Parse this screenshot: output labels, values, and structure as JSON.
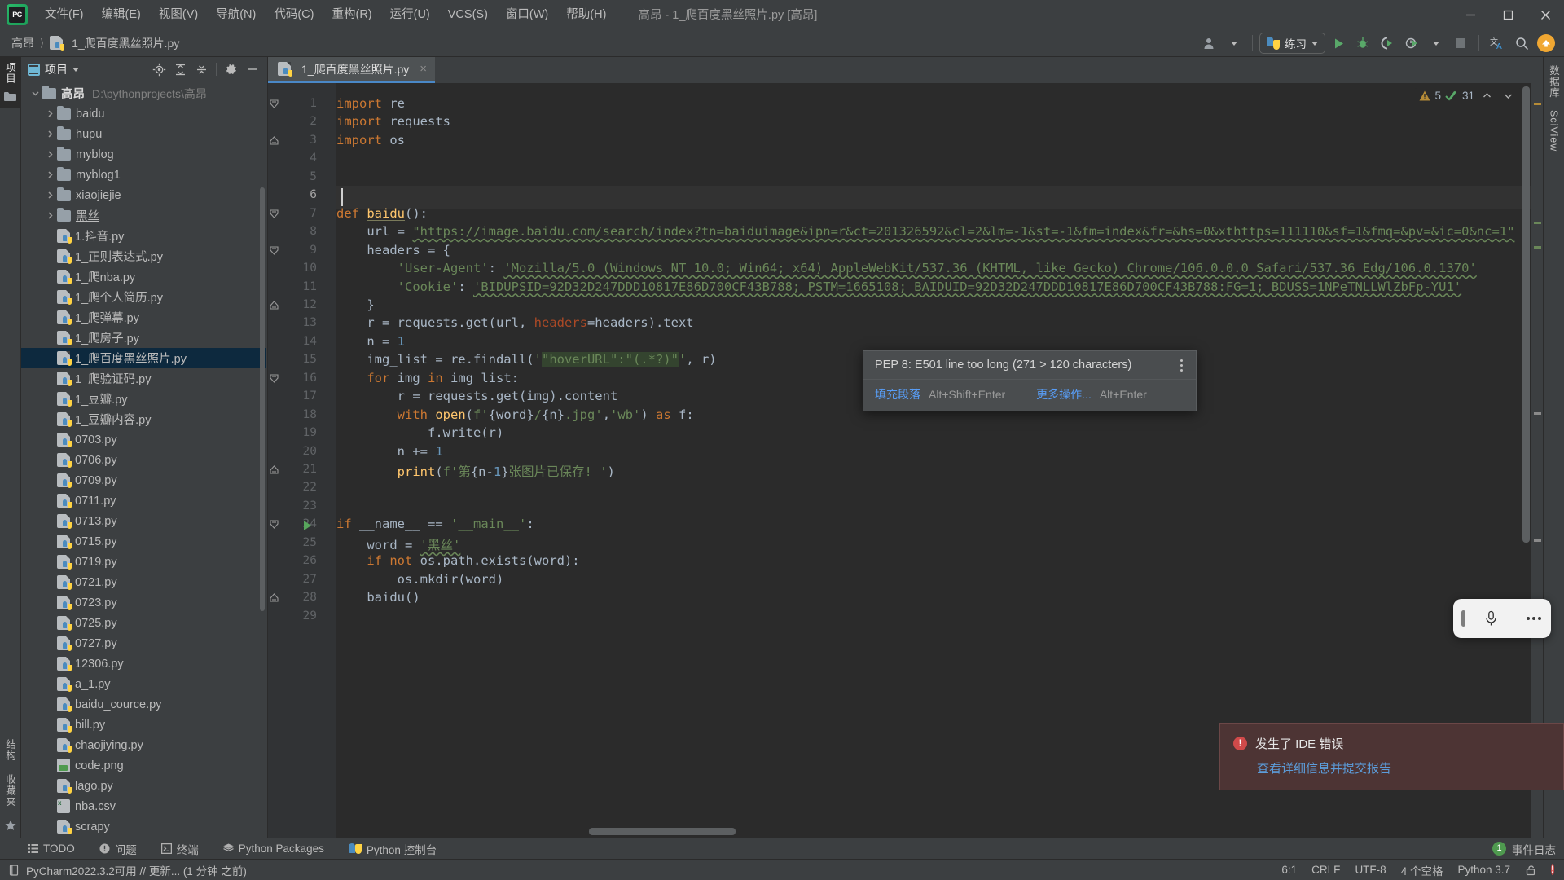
{
  "window": {
    "title": "高昂 - 1_爬百度黑丝照片.py [高昂]",
    "app_icon": "pycharm-logo"
  },
  "menubar": [
    {
      "label": "文件(F)",
      "accel": "F"
    },
    {
      "label": "编辑(E)",
      "accel": "E"
    },
    {
      "label": "视图(V)",
      "accel": "V"
    },
    {
      "label": "导航(N)",
      "accel": "N"
    },
    {
      "label": "代码(C)",
      "accel": "C"
    },
    {
      "label": "重构(R)",
      "accel": "R"
    },
    {
      "label": "运行(U)",
      "accel": "U"
    },
    {
      "label": "VCS(S)",
      "accel": "S"
    },
    {
      "label": "窗口(W)",
      "accel": "W"
    },
    {
      "label": "帮助(H)",
      "accel": "H"
    }
  ],
  "navbar": {
    "breadcrumb": [
      "高昂",
      "1_爬百度黑丝照片.py"
    ],
    "run_config": "练习",
    "toolbar_icons": [
      "user-avatar-icon",
      "run-icon",
      "debug-icon",
      "coverage-icon",
      "profile-icon",
      "stop-icon",
      "translate-icon",
      "search-everywhere-icon",
      "update-icon"
    ]
  },
  "project_panel": {
    "title": "项目",
    "actions": [
      "locate-icon",
      "expand-all-icon",
      "collapse-all-icon",
      "settings-gear-icon",
      "hide-icon"
    ],
    "root": {
      "label": "高昂",
      "path": "D:\\pythonprojects\\高昂"
    },
    "items": [
      {
        "label": "baidu",
        "type": "folder",
        "depth": 1,
        "expandable": true
      },
      {
        "label": "hupu",
        "type": "folder",
        "depth": 1,
        "expandable": true
      },
      {
        "label": "myblog",
        "type": "folder",
        "depth": 1,
        "expandable": true
      },
      {
        "label": "myblog1",
        "type": "folder",
        "depth": 1,
        "expandable": true
      },
      {
        "label": "xiaojiejie",
        "type": "folder",
        "depth": 1,
        "expandable": true
      },
      {
        "label": "黑丝",
        "type": "folder",
        "depth": 1,
        "expandable": true,
        "underline": true
      },
      {
        "label": "1.抖音.py",
        "type": "py",
        "depth": 1
      },
      {
        "label": "1_正则表达式.py",
        "type": "py",
        "depth": 1
      },
      {
        "label": "1_爬nba.py",
        "type": "py",
        "depth": 1
      },
      {
        "label": "1_爬个人简历.py",
        "type": "py",
        "depth": 1
      },
      {
        "label": "1_爬弹幕.py",
        "type": "py",
        "depth": 1
      },
      {
        "label": "1_爬房子.py",
        "type": "py",
        "depth": 1
      },
      {
        "label": "1_爬百度黑丝照片.py",
        "type": "py",
        "depth": 1,
        "selected": true
      },
      {
        "label": "1_爬验证码.py",
        "type": "py",
        "depth": 1
      },
      {
        "label": "1_豆瓣.py",
        "type": "py",
        "depth": 1
      },
      {
        "label": "1_豆瓣内容.py",
        "type": "py",
        "depth": 1
      },
      {
        "label": "0703.py",
        "type": "py",
        "depth": 1
      },
      {
        "label": "0706.py",
        "type": "py",
        "depth": 1
      },
      {
        "label": "0709.py",
        "type": "py",
        "depth": 1
      },
      {
        "label": "0711.py",
        "type": "py",
        "depth": 1
      },
      {
        "label": "0713.py",
        "type": "py",
        "depth": 1
      },
      {
        "label": "0715.py",
        "type": "py",
        "depth": 1
      },
      {
        "label": "0719.py",
        "type": "py",
        "depth": 1
      },
      {
        "label": "0721.py",
        "type": "py",
        "depth": 1
      },
      {
        "label": "0723.py",
        "type": "py",
        "depth": 1
      },
      {
        "label": "0725.py",
        "type": "py",
        "depth": 1
      },
      {
        "label": "0727.py",
        "type": "py",
        "depth": 1
      },
      {
        "label": "12306.py",
        "type": "py",
        "depth": 1
      },
      {
        "label": "a_1.py",
        "type": "py",
        "depth": 1
      },
      {
        "label": "baidu_cource.py",
        "type": "py",
        "depth": 1
      },
      {
        "label": "bill.py",
        "type": "py",
        "depth": 1
      },
      {
        "label": "chaojiying.py",
        "type": "py",
        "depth": 1
      },
      {
        "label": "code.png",
        "type": "img",
        "depth": 1
      },
      {
        "label": "lago.py",
        "type": "py",
        "depth": 1
      },
      {
        "label": "nba.csv",
        "type": "csv",
        "depth": 1
      },
      {
        "label": "scrapy",
        "type": "py",
        "depth": 1
      }
    ]
  },
  "left_strip": {
    "top": [
      "项目",
      "folder-icon"
    ],
    "bottom": [
      "结构",
      "收藏夹",
      "star-icon",
      "terminal-icon"
    ]
  },
  "right_strip": [
    "数据库",
    "SciView"
  ],
  "editor": {
    "tab": {
      "label": "1_爬百度黑丝照片.py",
      "icon": "python-file-icon",
      "close": "×"
    },
    "inspection": {
      "warnings": "5",
      "checks": "31",
      "up": "chevron-up-icon",
      "down": "chevron-down-icon"
    },
    "lines": [
      {
        "n": 1,
        "text": "import re"
      },
      {
        "n": 2,
        "text": "import requests"
      },
      {
        "n": 3,
        "text": "import os"
      },
      {
        "n": 4,
        "text": ""
      },
      {
        "n": 5,
        "text": ""
      },
      {
        "n": 6,
        "text": "",
        "current": true
      },
      {
        "n": 7,
        "text": "def baidu():"
      },
      {
        "n": 8,
        "text": "    url = \"https://image.baidu.com/search/index?tn=baiduimage&ipn=r&ct=201326592&cl=2&lm=-1&st=-1&fm=index&fr=&hs=0&xthttps=111110&sf=1&fmq=&pv=&ic=0&nc=1\""
      },
      {
        "n": 9,
        "text": "    headers = {"
      },
      {
        "n": 10,
        "text": "        'User-Agent': 'Mozilla/5.0 (Windows NT 10.0; Win64; x64) AppleWebKit/537.36 (KHTML, like Gecko) Chrome/106.0.0.0 Safari/537.36 Edg/106.0.1370'"
      },
      {
        "n": 11,
        "text": "        'Cookie': 'BIDUPSID=92D32D247DDD10817E86D700CF43B788; PSTM=1665108; BAIDUID=92D32D247DDD10817E86D700CF43B788:FG=1; BDUSS=1NPeTNLLWlZbFp-YU1'"
      },
      {
        "n": 12,
        "text": "    }"
      },
      {
        "n": 13,
        "text": "    r = requests.get(url, headers=headers).text"
      },
      {
        "n": 14,
        "text": "    n = 1"
      },
      {
        "n": 15,
        "text": "    img_list = re.findall('\"hoverURL\":\"(.*?)\"', r)"
      },
      {
        "n": 16,
        "text": "    for img in img_list:"
      },
      {
        "n": 17,
        "text": "        r = requests.get(img).content"
      },
      {
        "n": 18,
        "text": "        with open(f'{word}/{n}.jpg','wb') as f:"
      },
      {
        "n": 19,
        "text": "            f.write(r)"
      },
      {
        "n": 20,
        "text": "        n += 1"
      },
      {
        "n": 21,
        "text": "        print(f'第{n-1}张图片已保存! ')"
      },
      {
        "n": 22,
        "text": ""
      },
      {
        "n": 23,
        "text": ""
      },
      {
        "n": 24,
        "text": "if __name__ == '__main__':",
        "runnable": true
      },
      {
        "n": 25,
        "text": "    word = '黑丝'"
      },
      {
        "n": 26,
        "text": "    if not os.path.exists(word):"
      },
      {
        "n": 27,
        "text": "        os.mkdir(word)"
      },
      {
        "n": 28,
        "text": "    baidu()"
      },
      {
        "n": 29,
        "text": ""
      }
    ]
  },
  "intention_popup": {
    "message": "PEP 8: E501 line too long (271 > 120 characters)",
    "menu_icon": "more-vertical-icon",
    "actions": [
      {
        "label": "填充段落",
        "shortcut": "Alt+Shift+Enter"
      },
      {
        "label": "更多操作...",
        "shortcut": "Alt+Enter"
      }
    ]
  },
  "mini_toolbar": {
    "grip": "drag-handle-icon",
    "mic": "microphone-icon",
    "more": "ellipsis-icon"
  },
  "notification": {
    "icon": "error-icon",
    "title": "发生了 IDE 错误",
    "link": "查看详细信息并提交报告"
  },
  "toolwindow_bar": {
    "items": [
      {
        "label": "TODO",
        "icon": "todo-icon"
      },
      {
        "label": "问题",
        "icon": "problems-icon"
      },
      {
        "label": "终端",
        "icon": "terminal-icon"
      },
      {
        "label": "Python Packages",
        "icon": "packages-icon"
      },
      {
        "label": "Python 控制台",
        "icon": "python-console-icon"
      }
    ],
    "right": {
      "count": "1",
      "label": "事件日志"
    }
  },
  "statusbar": {
    "message": "PyCharm2022.3.2可用 // 更新... (1 分钟 之前)",
    "icon": "ide-update-icon",
    "right": [
      {
        "label": "6:1",
        "name": "caret-position"
      },
      {
        "label": "CRLF",
        "name": "line-separator"
      },
      {
        "label": "UTF-8",
        "name": "file-encoding"
      },
      {
        "label": "4 个空格",
        "name": "indent-size"
      },
      {
        "label": "Python 3.7",
        "name": "interpreter"
      },
      {
        "label": "lock-icon",
        "name": "readonly-toggle"
      },
      {
        "label": "error-icon",
        "name": "inspection-status"
      }
    ]
  },
  "colors": {
    "bg_chrome": "#3c3f41",
    "bg_editor": "#2b2b2b",
    "bg_gutter": "#313335",
    "accent_blue": "#4a88c7",
    "selection": "#0d293e",
    "keyword": "#cc7832",
    "string": "#6a8759",
    "number": "#6897bb",
    "function": "#ffc66d",
    "default_text": "#a9b7c6",
    "error_bg": "#4d3434",
    "link": "#589df6"
  }
}
